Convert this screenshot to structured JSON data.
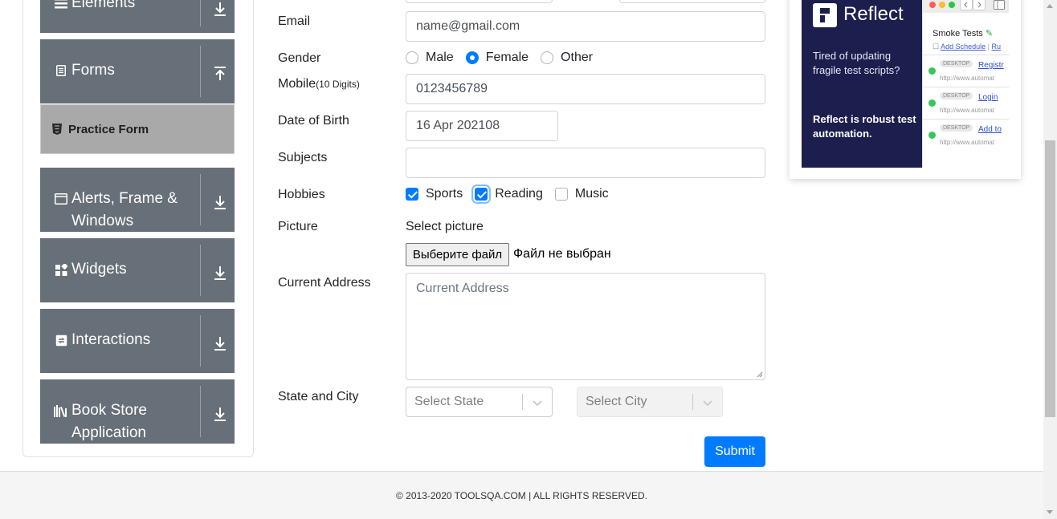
{
  "sidebar": {
    "groups": [
      {
        "label": "Elements",
        "icon": "list-icon"
      },
      {
        "label": "Forms",
        "icon": "document-icon"
      },
      {
        "label": "Alerts, Frame &",
        "label2": "Windows",
        "icon": "window-icon"
      },
      {
        "label": "Widgets",
        "icon": "widgets-icon"
      },
      {
        "label": "Interactions",
        "icon": "interactions-icon"
      },
      {
        "label": "Book Store",
        "label2": "Application",
        "icon": "books-icon"
      }
    ],
    "active_item": "Practice Form"
  },
  "form": {
    "email_label": "Email",
    "email_value": "name@gmail.com",
    "gender_label": "Gender",
    "gender_options": [
      "Male",
      "Female",
      "Other"
    ],
    "gender_selected": "Female",
    "mobile_label": "Mobile",
    "mobile_hint": "(10 Digits)",
    "mobile_value": "0123456789",
    "dob_label": "Date of Birth",
    "dob_value": "16 Apr 202108",
    "subjects_label": "Subjects",
    "subjects_value": "",
    "hobbies_label": "Hobbies",
    "hobbies": [
      {
        "label": "Sports",
        "checked": true
      },
      {
        "label": "Reading",
        "checked": true
      },
      {
        "label": "Music",
        "checked": false
      }
    ],
    "picture_label": "Picture",
    "picture_prompt": "Select picture",
    "file_button": "Выберите файл",
    "file_status": "Файл не выбран",
    "address_label": "Current Address",
    "address_placeholder": "Current Address",
    "state_city_label": "State and City",
    "state_placeholder": "Select State",
    "city_placeholder": "Select City",
    "submit_label": "Submit"
  },
  "ad": {
    "brand": "Reflect",
    "tagline": "Tired of updating fragile test scripts?",
    "pitch": "Reflect is robust test automation.",
    "panel_title": "Smoke Tests",
    "panel_action": "Add Schedule",
    "panel_action2": "Ru",
    "rows": [
      {
        "tag": "DESKTOP",
        "link": "Registr",
        "url": "http://www.automat"
      },
      {
        "tag": "DESKTOP",
        "link": "Login",
        "url": "http://www.automat"
      },
      {
        "tag": "DESKTOP",
        "link": "Add to",
        "url": "http://www.automat"
      }
    ]
  },
  "footer": {
    "text": "© 2013-2020 TOOLSQA.COM | ALL RIGHTS RESERVED."
  },
  "colors": {
    "accent": "#007bff",
    "sidebar_group": "#676f79",
    "active_item": "#a9a9a9",
    "ad_bg": "#1c1f4d"
  }
}
